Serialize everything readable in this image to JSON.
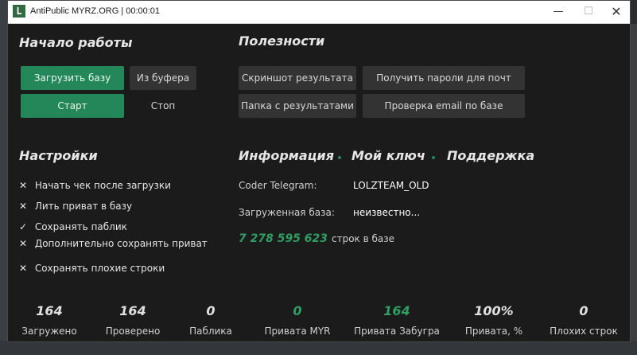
{
  "window": {
    "title": "AntiPublic MYRZ.ORG | 00:00:01",
    "app_icon_letter": "L",
    "minimize_glyph": "—",
    "maximize_glyph": "☐",
    "close_glyph": "✕"
  },
  "start": {
    "title": "Начало работы",
    "load_db": "Загрузить базу",
    "from_clipboard": "Из буфера",
    "start": "Старт",
    "stop": "Стоп"
  },
  "utilities": {
    "title": "Полезности",
    "screenshot": "Скриншот результата",
    "get_passwords": "Получить пароли для почт",
    "results_folder": "Папка с результатами",
    "check_email": "Проверка email по базе"
  },
  "settings": {
    "title": "Настройки",
    "options": [
      {
        "mark": "✕",
        "label": "Начать чек после загрузки",
        "checked": false
      },
      {
        "mark": "✕",
        "label": "Лить приват в базу",
        "checked": false
      },
      {
        "mark": "✓",
        "label": "Сохранять паблик",
        "checked": true
      },
      {
        "mark": "✕",
        "label": "Дополнительно сохранять приват",
        "checked": false
      },
      {
        "mark": "✕",
        "label": "Сохранять плохие строки",
        "checked": false
      }
    ]
  },
  "info": {
    "tabs": [
      "Информация",
      "Мой ключ",
      "Поддержка"
    ],
    "coder_label": "Coder Telegram:",
    "coder_value": "LOLZTEAM_OLD",
    "loaded_label": "Загруженная база:",
    "loaded_value": "неизвестно...",
    "lines_count": "7 278 595 623",
    "lines_label": "строк в базе"
  },
  "stats": [
    {
      "value": "164",
      "label": "Загружено",
      "green": false
    },
    {
      "value": "164",
      "label": "Проверено",
      "green": false
    },
    {
      "value": "0",
      "label": "Паблика",
      "green": false
    },
    {
      "value": "0",
      "label": "Привата MYR",
      "green": true
    },
    {
      "value": "164",
      "label": "Привата Забугра",
      "green": true
    },
    {
      "value": "100%",
      "label": "Привата, %",
      "green": false
    },
    {
      "value": "0",
      "label": "Плохих строк",
      "green": false
    }
  ],
  "colors": {
    "accent": "#23875a",
    "accent_text": "#2f9e63",
    "window_bg": "#1b1b1b",
    "button_bg": "#333333"
  }
}
